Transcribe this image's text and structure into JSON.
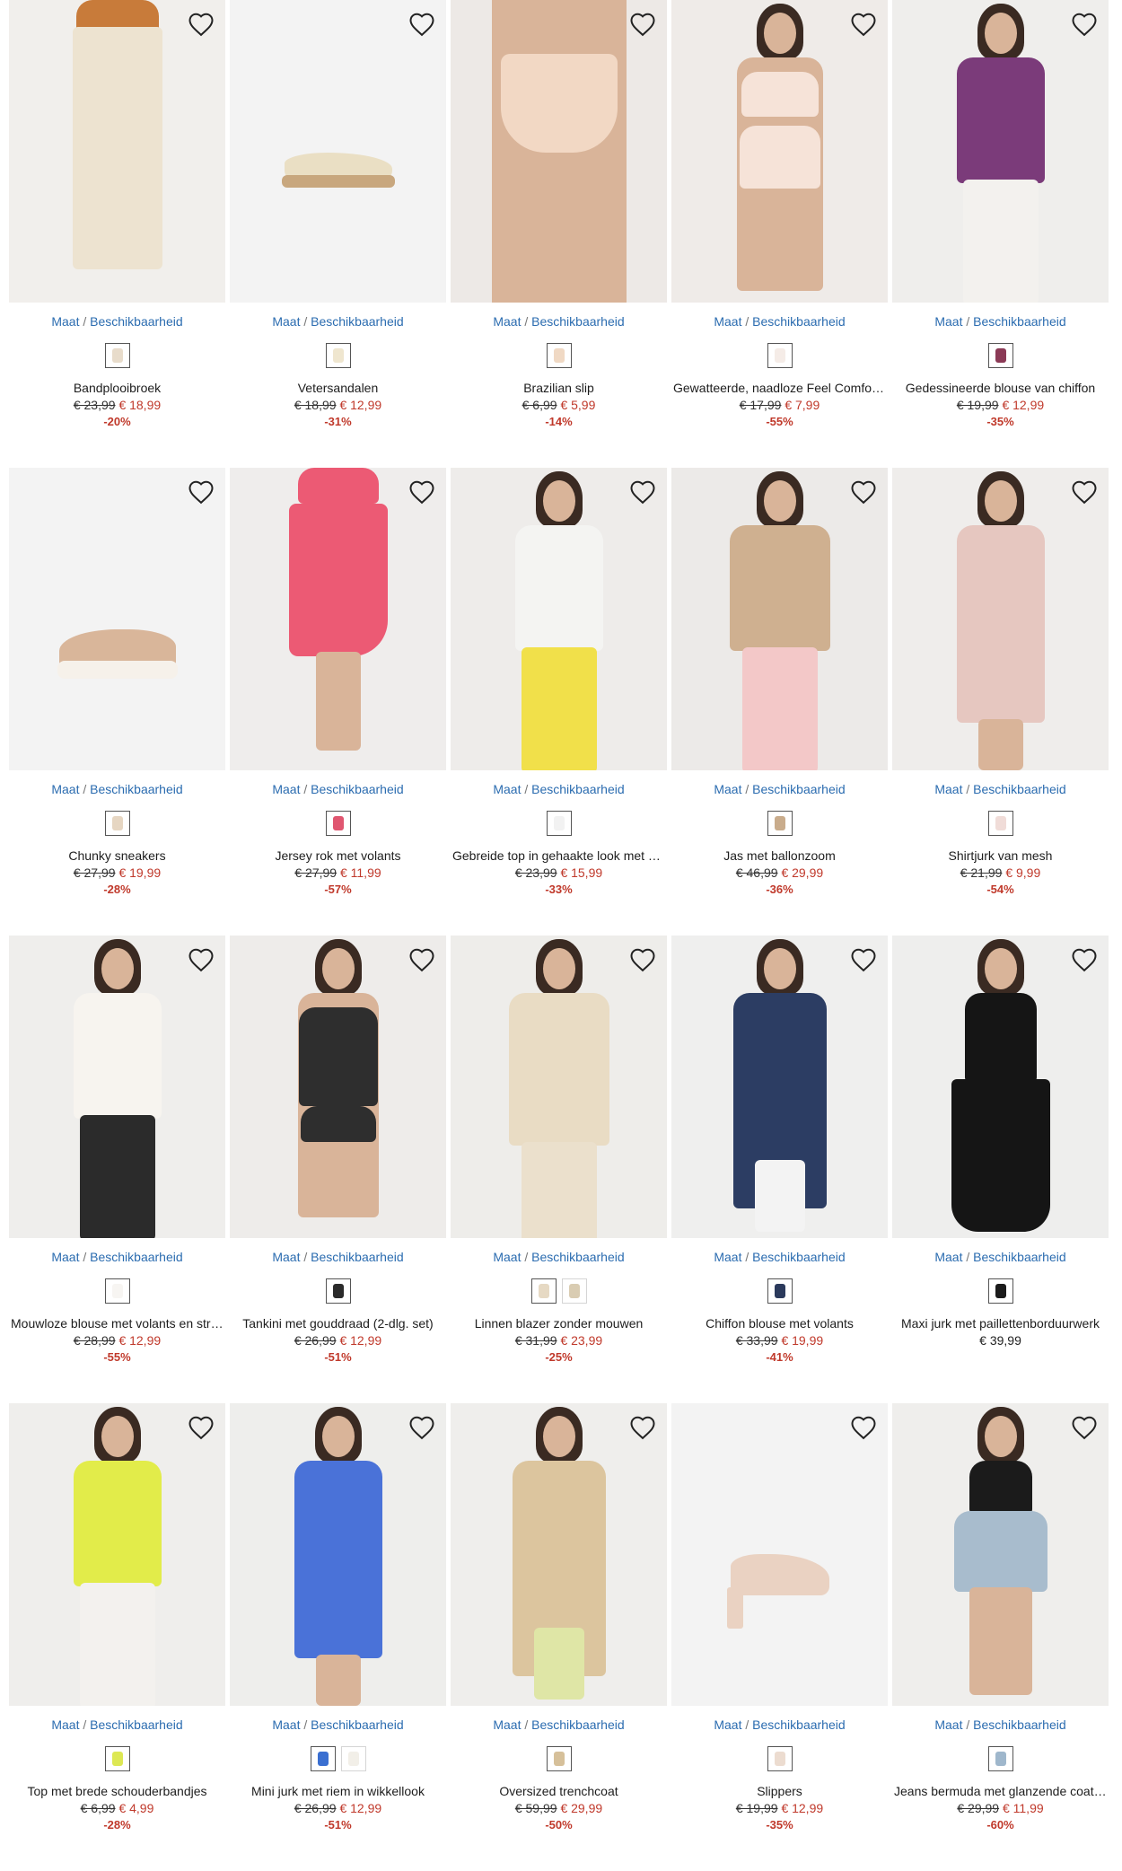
{
  "availability": {
    "part1": "Maat",
    "sep": " / ",
    "part2": "Beschikbaarheid"
  },
  "products": [
    {
      "name": "Bandplooibroek",
      "old_price": "€ 23,99",
      "price": "€ 18,99",
      "discount": "-20%",
      "swatches": [
        "#e8dccb"
      ],
      "bg": "#f1efec",
      "kind": "pants",
      "color": "#ede3d0"
    },
    {
      "name": "Vetersandalen",
      "old_price": "€ 18,99",
      "price": "€ 12,99",
      "discount": "-31%",
      "swatches": [
        "#efe6cf"
      ],
      "bg": "#f3f3f3",
      "kind": "sandal",
      "color": "#eadfc4"
    },
    {
      "name": "Brazilian slip",
      "old_price": "€ 6,99",
      "price": "€ 5,99",
      "discount": "-14%",
      "swatches": [
        "#f0d9c4"
      ],
      "bg": "#ede9e6",
      "kind": "lingerie",
      "color": "#f2d8c4"
    },
    {
      "name": "Gewatteerde, naadloze Feel Comfort beha",
      "old_price": "€ 17,99",
      "price": "€ 7,99",
      "discount": "-55%",
      "swatches": [
        "#f5ece7"
      ],
      "bg": "#efebe8",
      "kind": "bra",
      "color": "#f6e3d8"
    },
    {
      "name": "Gedessineerde blouse van chiffon",
      "old_price": "€ 19,99",
      "price": "€ 12,99",
      "discount": "-35%",
      "swatches": [
        "#8b3a56"
      ],
      "bg": "#efeeec",
      "kind": "blouse",
      "color": "#7b3b7a"
    },
    {
      "name": "Chunky sneakers",
      "old_price": "€ 27,99",
      "price": "€ 19,99",
      "discount": "-28%",
      "swatches": [
        "#e6d6c2"
      ],
      "bg": "#f3f3f3",
      "kind": "sneaker",
      "color": "#d9b69a"
    },
    {
      "name": "Jersey rok met volants",
      "old_price": "€ 27,99",
      "price": "€ 11,99",
      "discount": "-57%",
      "swatches": [
        "#e05670"
      ],
      "bg": "#efedec",
      "kind": "skirt",
      "color": "#ec5a74"
    },
    {
      "name": "Gebreide top in gehaakte look met volants",
      "old_price": "€ 23,99",
      "price": "€ 15,99",
      "discount": "-33%",
      "swatches": [
        "#f2f2f2"
      ],
      "bg": "#eeecea",
      "kind": "top",
      "color": "#f4f4f2"
    },
    {
      "name": "Jas met ballonzoom",
      "old_price": "€ 46,99",
      "price": "€ 29,99",
      "discount": "-36%",
      "swatches": [
        "#c9ac8c"
      ],
      "bg": "#eceae8",
      "kind": "jacket",
      "color": "#cfb090"
    },
    {
      "name": "Shirtjurk van mesh",
      "old_price": "€ 21,99",
      "price": "€ 9,99",
      "discount": "-54%",
      "swatches": [
        "#f0dcd8"
      ],
      "bg": "#efedeb",
      "kind": "dress",
      "color": "#e6c7c0"
    },
    {
      "name": "Mouwloze blouse met volants en strikbandjes",
      "old_price": "€ 28,99",
      "price": "€ 12,99",
      "discount": "-55%",
      "swatches": [
        "#f7f5f2"
      ],
      "bg": "#efeeec",
      "kind": "blouse",
      "color": "#f7f4ef"
    },
    {
      "name": "Tankini met gouddraad (2-dlg. set)",
      "old_price": "€ 26,99",
      "price": "€ 12,99",
      "discount": "-51%",
      "swatches": [
        "#2b2b2b"
      ],
      "bg": "#eeecea",
      "kind": "swim",
      "color": "#2e2e2e"
    },
    {
      "name": "Linnen blazer zonder mouwen",
      "old_price": "€ 31,99",
      "price": "€ 23,99",
      "discount": "-25%",
      "swatches": [
        "#e6d9c3",
        "#d9ccb2"
      ],
      "bg": "#eeedea",
      "kind": "blazer",
      "color": "#e9dcc4"
    },
    {
      "name": "Chiffon blouse met volants",
      "old_price": "€ 33,99",
      "price": "€ 19,99",
      "discount": "-41%",
      "swatches": [
        "#2b3a5c"
      ],
      "bg": "#efefee",
      "kind": "longblouse",
      "color": "#2c3d63"
    },
    {
      "name": "Maxi jurk met paillettenborduurwerk",
      "old_price": "",
      "price": "€ 39,99",
      "discount": "",
      "swatches": [
        "#1b1b1b"
      ],
      "bg": "#eeeeed",
      "kind": "maxi",
      "color": "#151515"
    },
    {
      "name": "Top met brede schouderbandjes",
      "old_price": "€ 6,99",
      "price": "€ 4,99",
      "discount": "-28%",
      "swatches": [
        "#dde854"
      ],
      "bg": "#efeeec",
      "kind": "tank",
      "color": "#e2ec4a"
    },
    {
      "name": "Mini jurk met riem in wikkellook",
      "old_price": "€ 26,99",
      "price": "€ 12,99",
      "discount": "-51%",
      "swatches": [
        "#3a6fd1",
        "#f2efe8"
      ],
      "bg": "#eeeeec",
      "kind": "wrap",
      "color": "#4a72d8"
    },
    {
      "name": "Oversized trenchcoat",
      "old_price": "€ 59,99",
      "price": "€ 29,99",
      "discount": "-50%",
      "swatches": [
        "#d6c09a"
      ],
      "bg": "#efeeec",
      "kind": "trench",
      "color": "#dcc59e"
    },
    {
      "name": "Slippers",
      "old_price": "€ 19,99",
      "price": "€ 12,99",
      "discount": "-35%",
      "swatches": [
        "#ecdcd0"
      ],
      "bg": "#f3f3f3",
      "kind": "mule",
      "color": "#ead2c2"
    },
    {
      "name": "Jeans bermuda met glanzende coating",
      "old_price": "€ 29,99",
      "price": "€ 11,99",
      "discount": "-60%",
      "swatches": [
        "#9fb7cc"
      ],
      "bg": "#efeeec",
      "kind": "shorts",
      "color": "#a8bccd"
    }
  ]
}
